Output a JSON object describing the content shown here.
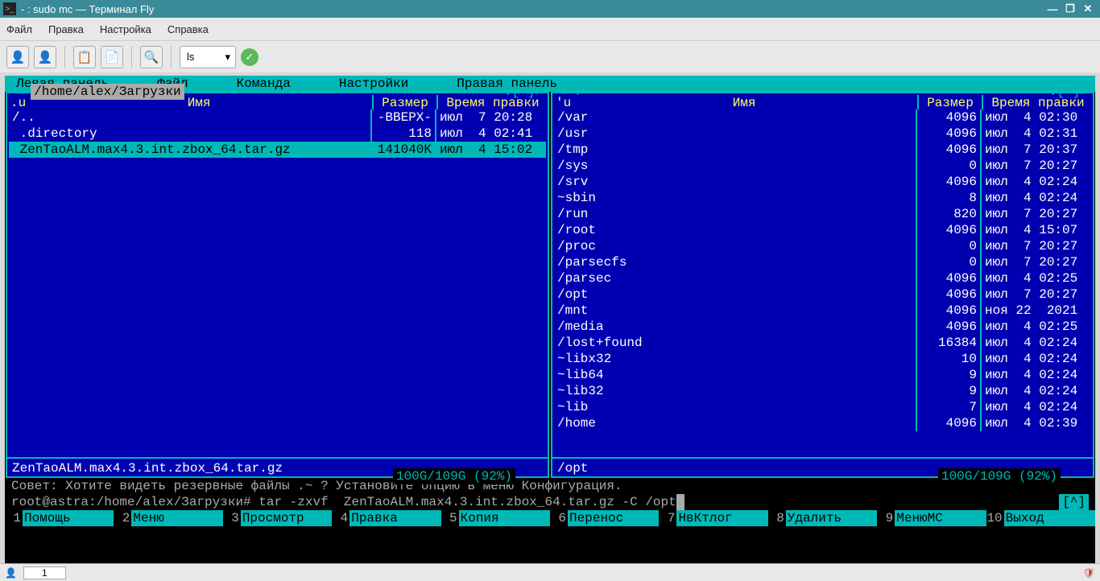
{
  "window": {
    "title": "- : sudo mc — Терминал Fly"
  },
  "menubar": [
    "Файл",
    "Правка",
    "Настройка",
    "Справка"
  ],
  "toolbar": {
    "select_value": "ls"
  },
  "mc_menu": [
    "Левая панель",
    "Файл",
    "Команда",
    "Настройки",
    "Правая панель"
  ],
  "left_panel": {
    "path": "/home/alex/Загрузки",
    "headers": {
      "sort": ".u",
      "name": "Имя",
      "size": "Размер",
      "time": "Время правки"
    },
    "rows": [
      {
        "name": "/..",
        "size": "-ВВЕРХ-",
        "time": "июл  7 20:28",
        "sel": false
      },
      {
        "name": " .directory",
        "size": "118",
        "time": "июл  4 02:41",
        "sel": false
      },
      {
        "name": " ZenTaoALM.max4.3.int.zbox_64.tar.gz",
        "size": "141040K",
        "time": "июл  4 15:02",
        "sel": true
      }
    ],
    "footer": "ZenTaoALM.max4.3.int.zbox_64.tar.gz",
    "space": "100G/109G (92%)"
  },
  "right_panel": {
    "path": "/",
    "headers": {
      "sort": "'u",
      "name": "Имя",
      "size": "Размер",
      "time": "Время правки"
    },
    "rows": [
      {
        "name": "/var",
        "size": "4096",
        "time": "июл  4 02:30"
      },
      {
        "name": "/usr",
        "size": "4096",
        "time": "июл  4 02:31"
      },
      {
        "name": "/tmp",
        "size": "4096",
        "time": "июл  7 20:37"
      },
      {
        "name": "/sys",
        "size": "0",
        "time": "июл  7 20:27"
      },
      {
        "name": "/srv",
        "size": "4096",
        "time": "июл  4 02:24"
      },
      {
        "name": "~sbin",
        "size": "8",
        "time": "июл  4 02:24"
      },
      {
        "name": "/run",
        "size": "820",
        "time": "июл  7 20:27"
      },
      {
        "name": "/root",
        "size": "4096",
        "time": "июл  4 15:07"
      },
      {
        "name": "/proc",
        "size": "0",
        "time": "июл  7 20:27"
      },
      {
        "name": "/parsecfs",
        "size": "0",
        "time": "июл  7 20:27"
      },
      {
        "name": "/parsec",
        "size": "4096",
        "time": "июл  4 02:25"
      },
      {
        "name": "/opt",
        "size": "4096",
        "time": "июл  7 20:27"
      },
      {
        "name": "/mnt",
        "size": "4096",
        "time": "ноя 22  2021"
      },
      {
        "name": "/media",
        "size": "4096",
        "time": "июл  4 02:25"
      },
      {
        "name": "/lost+found",
        "size": "16384",
        "time": "июл  4 02:24"
      },
      {
        "name": "~libx32",
        "size": "10",
        "time": "июл  4 02:24"
      },
      {
        "name": "~lib64",
        "size": "9",
        "time": "июл  4 02:24"
      },
      {
        "name": "~lib32",
        "size": "9",
        "time": "июл  4 02:24"
      },
      {
        "name": "~lib",
        "size": "7",
        "time": "июл  4 02:24"
      },
      {
        "name": "/home",
        "size": "4096",
        "time": "июл  4 02:39"
      }
    ],
    "footer": "/opt",
    "space": "100G/109G (92%)"
  },
  "hint": "Совет: Хотите видеть резервные файлы .~ ? Установите опцию в меню Конфигурация.",
  "prompt": {
    "ps1": "root@astra:/home/alex/Загрузки# ",
    "cmd": "tar -zxvf  ZenTaoALM.max4.3.int.zbox_64.tar.gz -C /opt",
    "tag": "[^]"
  },
  "fkeys": [
    {
      "n": "1",
      "l": "Помощь"
    },
    {
      "n": "2",
      "l": "Меню"
    },
    {
      "n": "3",
      "l": "Просмотр"
    },
    {
      "n": "4",
      "l": "Правка"
    },
    {
      "n": "5",
      "l": "Копия"
    },
    {
      "n": "6",
      "l": "Перенос"
    },
    {
      "n": "7",
      "l": "НвКтлог"
    },
    {
      "n": "8",
      "l": "Удалить"
    },
    {
      "n": "9",
      "l": "МенюMC"
    },
    {
      "n": "10",
      "l": "Выход"
    }
  ],
  "taskbar": {
    "tab": "1"
  }
}
